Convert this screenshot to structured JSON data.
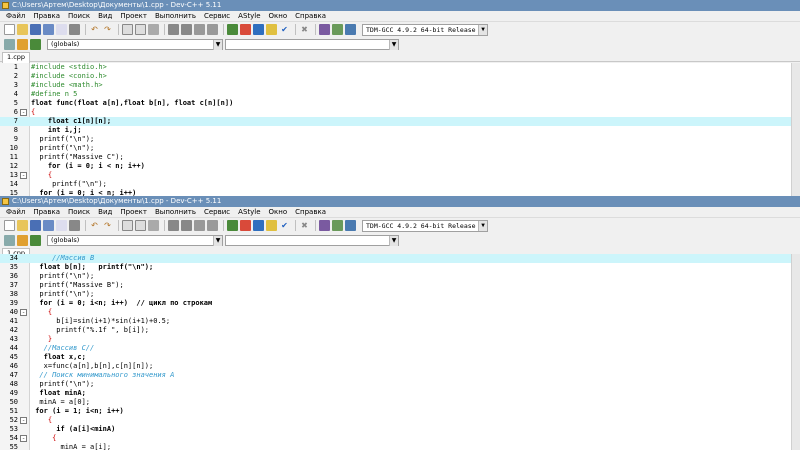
{
  "window1": {
    "title": "C:\\Users\\Артем\\Desktop\\Документы\\1.cpp - Dev-C++ 5.11",
    "tab": "1.cpp",
    "lines": [
      {
        "n": "1",
        "code": "#include <stdio.h>",
        "style": "pp"
      },
      {
        "n": "2",
        "code": "#include <conio.h>",
        "style": "pp"
      },
      {
        "n": "3",
        "code": "#include <math.h>",
        "style": "pp"
      },
      {
        "n": "4",
        "code": "#define n 5",
        "style": "pp"
      },
      {
        "n": "5",
        "code": "float func(float a[n],float b[n], float c[n][n])",
        "style": "kw"
      },
      {
        "n": "6",
        "code": "{",
        "style": "op",
        "fold": "-"
      },
      {
        "n": "7",
        "code": "    float c1[n][n];",
        "style": "kw",
        "active": true
      },
      {
        "n": "8",
        "code": "    int i,j;",
        "style": "kw"
      },
      {
        "n": "9",
        "code": "  printf(\"\\n\");",
        "style": "plain"
      },
      {
        "n": "10",
        "code": "  printf(\"\\n\");",
        "style": "plain"
      },
      {
        "n": "11",
        "code": "  printf(\"Massive C\");",
        "style": "plain"
      },
      {
        "n": "12",
        "code": "    for (i = 0; i < n; i++)",
        "style": "kw"
      },
      {
        "n": "13",
        "code": "    {",
        "style": "op",
        "fold": "-"
      },
      {
        "n": "14",
        "code": "     printf(\"\\n\");",
        "style": "plain"
      },
      {
        "n": "15",
        "code": "  for (i = 0; i < n; i++)",
        "style": "kw"
      }
    ]
  },
  "window2": {
    "title": "C:\\Users\\Артем\\Desktop\\Документы\\1.cpp - Dev-C++ 5.11",
    "tab": "1.cpp",
    "lines": [
      {
        "n": "34",
        "code": "     //Массив B",
        "style": "cmt",
        "active": true
      },
      {
        "n": "35",
        "code": "  float b[n];   printf(\"\\n\");",
        "style": "kw"
      },
      {
        "n": "36",
        "code": "  printf(\"\\n\");",
        "style": "plain"
      },
      {
        "n": "37",
        "code": "  printf(\"Massive B\");",
        "style": "plain"
      },
      {
        "n": "38",
        "code": "  printf(\"\\n\");",
        "style": "plain"
      },
      {
        "n": "39",
        "code": "  for (i = 0; i<n; i++)  // цикл по строкам",
        "style": "kw"
      },
      {
        "n": "40",
        "code": "    {",
        "style": "op",
        "fold": "-"
      },
      {
        "n": "41",
        "code": "      b[i]=sin(i+1)*sin(i+1)+0.5;",
        "style": "plain"
      },
      {
        "n": "42",
        "code": "      printf(\"%.1f \", b[i]);",
        "style": "plain"
      },
      {
        "n": "43",
        "code": "    }",
        "style": "op"
      },
      {
        "n": "44",
        "code": "   //Массив C//",
        "style": "cmt"
      },
      {
        "n": "45",
        "code": "   float x,c;",
        "style": "kw"
      },
      {
        "n": "46",
        "code": "   x=func(a[n],b[n],c[n][n]);",
        "style": "plain"
      },
      {
        "n": "47",
        "code": "  // Поиск минимального значения A",
        "style": "cmt"
      },
      {
        "n": "48",
        "code": "  printf(\"\\n\");",
        "style": "plain"
      },
      {
        "n": "49",
        "code": "  float minA;",
        "style": "kw"
      },
      {
        "n": "50",
        "code": "  minA = a[0];",
        "style": "plain"
      },
      {
        "n": "51",
        "code": " for (i = 1; i<n; i++)",
        "style": "kw"
      },
      {
        "n": "52",
        "code": "    {",
        "style": "op",
        "fold": "-"
      },
      {
        "n": "53",
        "code": "      if (a[i]<minA)",
        "style": "kw"
      },
      {
        "n": "54",
        "code": "     {",
        "style": "op",
        "fold": "-"
      },
      {
        "n": "55",
        "code": "       minA = a[i];",
        "style": "plain"
      }
    ]
  },
  "menu": [
    "Файл",
    "Правка",
    "Поиск",
    "Вид",
    "Проект",
    "Выполнить",
    "Сервис",
    "AStyle",
    "Окно",
    "Справка"
  ],
  "compiler": "TDM-GCC 4.9.2 64-bit Release",
  "scope_combo": "(globals)",
  "colors": {
    "titlebar": "#6a8fb8",
    "active_line": "#ccf5fb",
    "comment": "#3399cc",
    "preprocessor": "#2e8b2e"
  }
}
